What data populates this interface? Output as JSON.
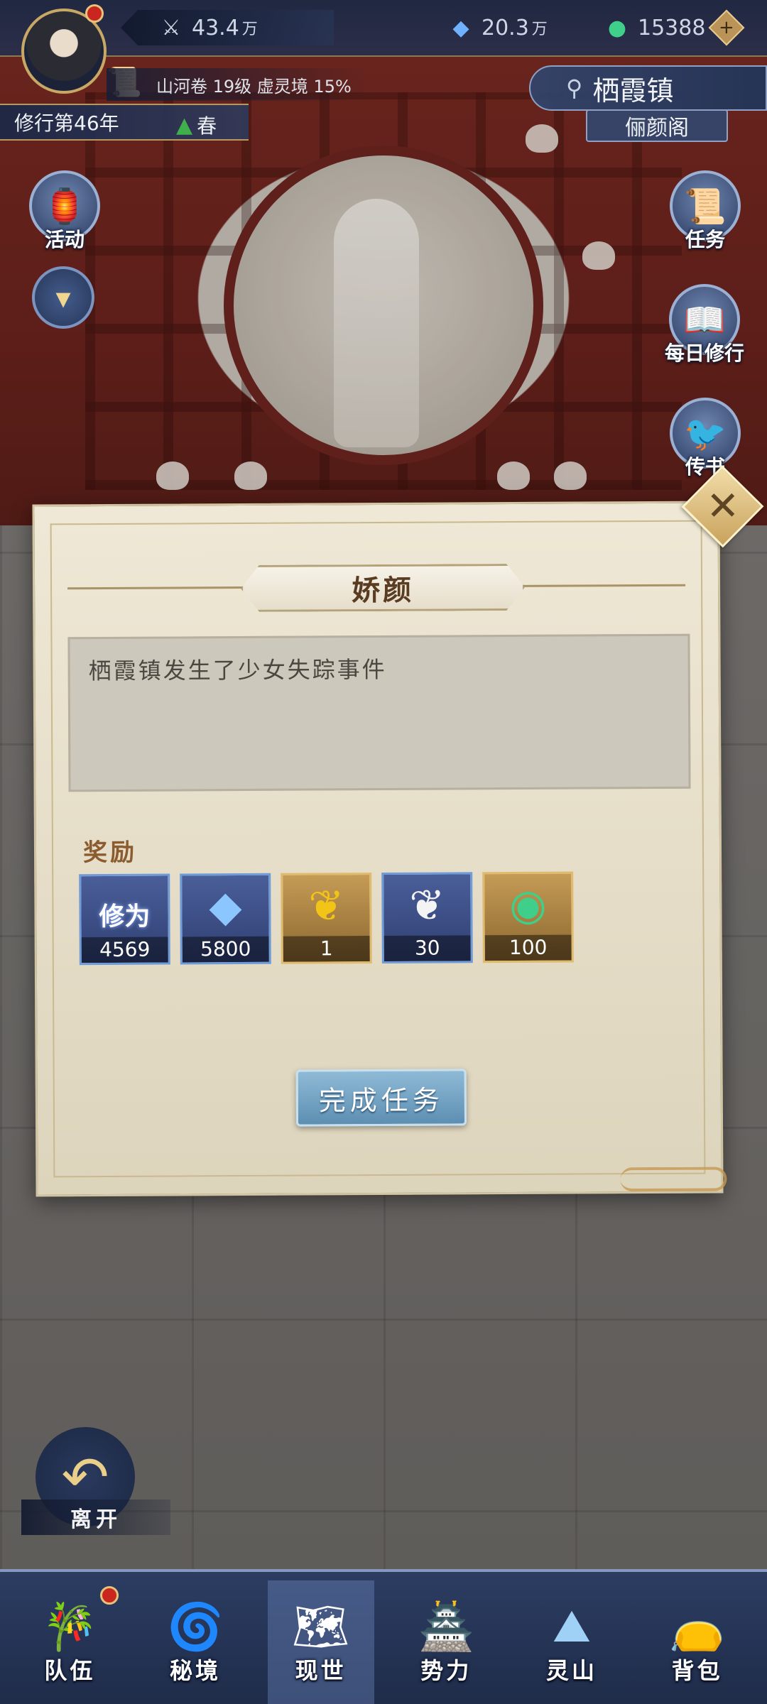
{
  "hud": {
    "power_value": "43.4",
    "power_unit": "万",
    "crystal_value": "20.3",
    "crystal_unit": "万",
    "jade_value": "15388",
    "plus_icon": "+",
    "scroll_info": "山河卷 19级  虚灵境 15%",
    "year": "修行第46年",
    "season": "春"
  },
  "location": {
    "city": "栖霞镇",
    "place": "俪颜阁"
  },
  "side_buttons": {
    "activity": "活动",
    "task": "任务",
    "daily": "每日修行",
    "letter": "传书"
  },
  "dialog": {
    "title": "娇颜",
    "description": "栖霞镇发生了少女失踪事件",
    "reward_label": "奖励",
    "rewards": [
      {
        "name": "修为",
        "qty": "4569",
        "style": "blue",
        "icon": "cultivation-text"
      },
      {
        "name": "",
        "qty": "5800",
        "style": "blue",
        "icon": "crystal-icon"
      },
      {
        "name": "",
        "qty": "1",
        "style": "gold",
        "icon": "gold-ginkgo-icon"
      },
      {
        "name": "",
        "qty": "30",
        "style": "blue",
        "icon": "silver-ginkgo-icon"
      },
      {
        "name": "",
        "qty": "100",
        "style": "gold",
        "icon": "jade-pendant-icon"
      }
    ],
    "complete_button": "完成任务",
    "close_icon": "✕"
  },
  "leave_button": "离开",
  "bottom_nav": [
    {
      "label": "队伍"
    },
    {
      "label": "秘境"
    },
    {
      "label": "现世"
    },
    {
      "label": "势力"
    },
    {
      "label": "灵山"
    },
    {
      "label": "背包"
    }
  ],
  "colors": {
    "hud_blue": "#1c2844",
    "gold_accent": "#c8a865",
    "parchment": "#e8e0cb",
    "reward_label": "#8a5c2f"
  }
}
